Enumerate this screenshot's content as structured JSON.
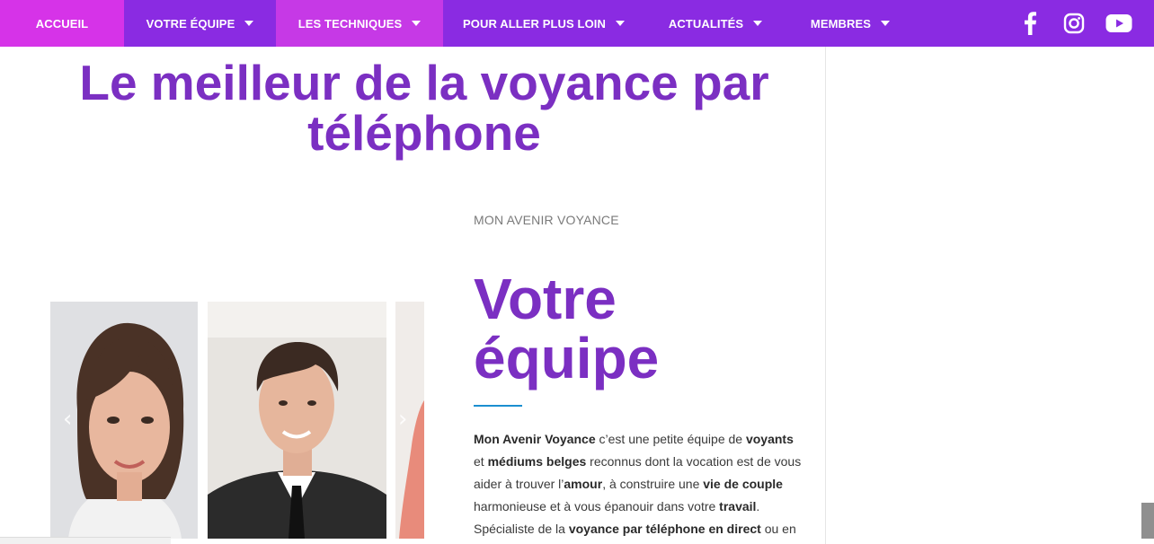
{
  "nav": {
    "items": [
      {
        "label": "ACCUEIL",
        "has_dropdown": false
      },
      {
        "label": "VOTRE ÉQUIPE",
        "has_dropdown": true
      },
      {
        "label": "LES TECHNIQUES",
        "has_dropdown": true
      },
      {
        "label": "POUR ALLER PLUS LOIN",
        "has_dropdown": true
      },
      {
        "label": "ACTUALITÉS",
        "has_dropdown": true
      },
      {
        "label": "MEMBRES",
        "has_dropdown": true
      }
    ],
    "social": [
      "facebook-icon",
      "instagram-icon",
      "youtube-icon"
    ],
    "colors": {
      "bar": "#8a2be2",
      "active": "#d633e8"
    }
  },
  "hero": {
    "title_line1": "Le meilleur de la voyance par",
    "title_line2": "téléphone"
  },
  "section": {
    "overline": "MON AVENIR VOYANCE",
    "title_line1": "Votre",
    "title_line2": "équipe",
    "paragraph": [
      {
        "b": "Mon Avenir Voyance",
        "t": " c’est une petite équipe de "
      },
      {
        "b": "voyants",
        "t": " et "
      },
      {
        "b": "médiums belges",
        "t": " reconnus dont la vocation est de vous aider à trouver l’"
      },
      {
        "b": "amour",
        "t": ", à construire une "
      },
      {
        "b": "vie de couple",
        "t": " harmonieuse et à vous épanouir dans votre "
      },
      {
        "b": "travail",
        "t": ". Spécialiste de la "
      },
      {
        "b": "voyance par téléphone en direct",
        "t": " ou en"
      }
    ]
  },
  "carousel": {
    "prev_label": "‹",
    "next_label": "›"
  }
}
